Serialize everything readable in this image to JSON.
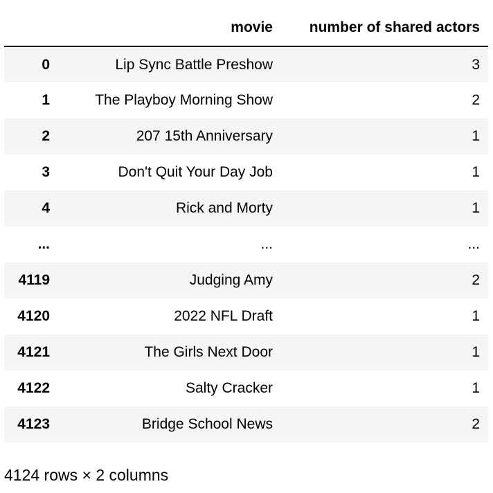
{
  "table": {
    "columns": {
      "index": "",
      "movie": "movie",
      "shared": "number of shared actors"
    },
    "rows": [
      {
        "index": "0",
        "movie": "Lip Sync Battle Preshow",
        "shared": "3"
      },
      {
        "index": "1",
        "movie": "The Playboy Morning Show",
        "shared": "2"
      },
      {
        "index": "2",
        "movie": "207 15th Anniversary",
        "shared": "1"
      },
      {
        "index": "3",
        "movie": "Don't Quit Your Day Job",
        "shared": "1"
      },
      {
        "index": "4",
        "movie": "Rick and Morty",
        "shared": "1"
      },
      {
        "index": "...",
        "movie": "...",
        "shared": "..."
      },
      {
        "index": "4119",
        "movie": "Judging Amy",
        "shared": "2"
      },
      {
        "index": "4120",
        "movie": "2022 NFL Draft",
        "shared": "1"
      },
      {
        "index": "4121",
        "movie": "The Girls Next Door",
        "shared": "1"
      },
      {
        "index": "4122",
        "movie": "Salty Cracker",
        "shared": "1"
      },
      {
        "index": "4123",
        "movie": "Bridge School News",
        "shared": "2"
      }
    ]
  },
  "caption": "4124 rows × 2 columns"
}
